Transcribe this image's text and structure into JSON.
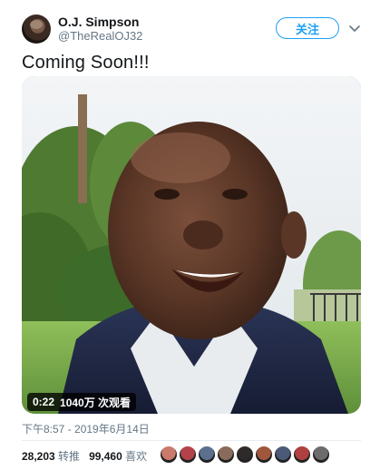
{
  "user": {
    "name": "O.J. Simpson",
    "handle": "@TheRealOJ32",
    "avatar_icon": "avatar-photo"
  },
  "follow_button": {
    "label": "关注"
  },
  "menu": {
    "icon": "chevron-down-icon"
  },
  "tweet": {
    "text": "Coming Soon!!!"
  },
  "video": {
    "duration": "0:22",
    "views": "1040万 次观看"
  },
  "meta": {
    "timestamp": "下午8:57 - 2019年6月14日"
  },
  "stats": {
    "retweets_count": "28,203",
    "retweets_label": "转推",
    "likes_count": "99,460",
    "likes_label": "喜欢"
  },
  "likers": {
    "colors": [
      "#c97a6a",
      "#b3424a",
      "#5b6f8f",
      "#8a6b5b",
      "#2f2a2a",
      "#a0563c",
      "#4a5a78",
      "#b04040",
      "#6c6c6c"
    ]
  },
  "colors": {
    "accent": "#1da1f2",
    "muted": "#657786"
  }
}
